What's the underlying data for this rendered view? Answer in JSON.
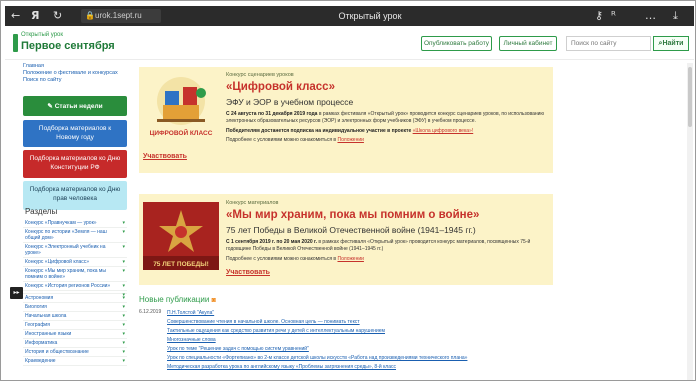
{
  "browser": {
    "url": "urok.1sept.ru",
    "title": "Открытый урок",
    "back_icon": "arrow-left-icon",
    "forward_icon": "yandex-icon",
    "reload_icon": "reload-icon",
    "lock_icon": "lock-icon"
  },
  "header": {
    "logo_small": "Открытый урок",
    "logo_big": "Первое сентября",
    "publish_label": "Опубликовать работу",
    "cabinet_label": "Личный кабинет",
    "search_placeholder": "Поиск по сайту",
    "search_button": "Найти",
    "accent": "#2e9b4a"
  },
  "sidebar": {
    "top_links": [
      "Главная",
      "Положение о фестивале и конкурсах",
      "Поиск по сайту"
    ],
    "btn_articles": "Статьи недели",
    "btn_new_year": "Подборка материалов к Новому году",
    "btn_constitution": "Подборка материалов ко Дню Конституции РФ",
    "btn_human_rights": "Подборка материалов ко Дню прав человека",
    "sections_heading": "Разделы",
    "sections": [
      "Конкурс «Правнучкам — урок»",
      "Конкурс по истории «Земля — наш общий дом»",
      "Конкурс «Электронный учебник на уроке»",
      "Конкурс «Цифровой класс»",
      "Конкурс «Мы мир храним, пока мы помним о войне»",
      "Конкурс «История регионов России»",
      "",
      "Астрономия",
      "Биология",
      "Начальная школа",
      "География",
      "Иностранные языки",
      "Информатика",
      "История и обществознание",
      "Краеведение"
    ]
  },
  "card1": {
    "sup": "Конкурс сценариев уроков",
    "title": "«Цифровой класс»",
    "subtitle": "ЭФУ и ЭОР в учебном процессе",
    "body1_bold": "С 24 августа по 31 декабря 2019 года",
    "body1": "в рамках фестиваля «Открытый урок» проводится конкурс сценариев уроков, по использованию электронных образовательных ресурсов (ЭОР) и электронных форм учебников (ЭФУ) в учебном процессе.",
    "body2": "Победителям достанется подписка на индивидуальное участие в проекте",
    "body2_link": "«Школа цифрового века»!",
    "body3": "Подробнее с условиями можно ознакомиться в",
    "body3_link": "Положении",
    "image_caption": "ЦИФРОВОЙ КЛАСС",
    "participate": "Участвовать"
  },
  "card2": {
    "sup": "Конкурс материалов",
    "title": "«Мы мир храним, пока мы помним о войне»",
    "subtitle": "75 лет Победы в Великой Отечественной войне (1941–1945 гг.)",
    "body1_bold": "С 1 сентября 2019 г. по 20 мая 2020 г.",
    "body1": "в рамках фестиваля «Открытый урок» проводится конкурс материалов, посвященных 75-й годовщине Победы в Великой Отечественной войне (1941–1945 гг.)",
    "body3": "Подробнее с условиями можно ознакомиться в",
    "body3_link": "Положении",
    "image_caption": "75 ЛЕТ ПОБЕДЫ!",
    "participate": "Участвовать"
  },
  "news": {
    "heading": "Новые публикации",
    "rss_icon": "rss-icon",
    "date": "6.12.2019",
    "items": [
      "П.Н.Толстой \"Акула\"",
      "Совершенствование чтения в начальной школе. Основная цель — понимать текст",
      "Тактильные ощущения как средство развития речи у детей с интеллектуальным нарушением",
      "Многозначные слова",
      "Урок по теме \"Решение задач с помощью систем уравнений\"",
      "Урок по специальности «Фортепиано» во 2-м классе детской школы искусств «Работа над произведениями технического плана»",
      "Методическая разработка урока по английскому языку «Проблемы загрязнения среды», 8-й класс"
    ]
  }
}
